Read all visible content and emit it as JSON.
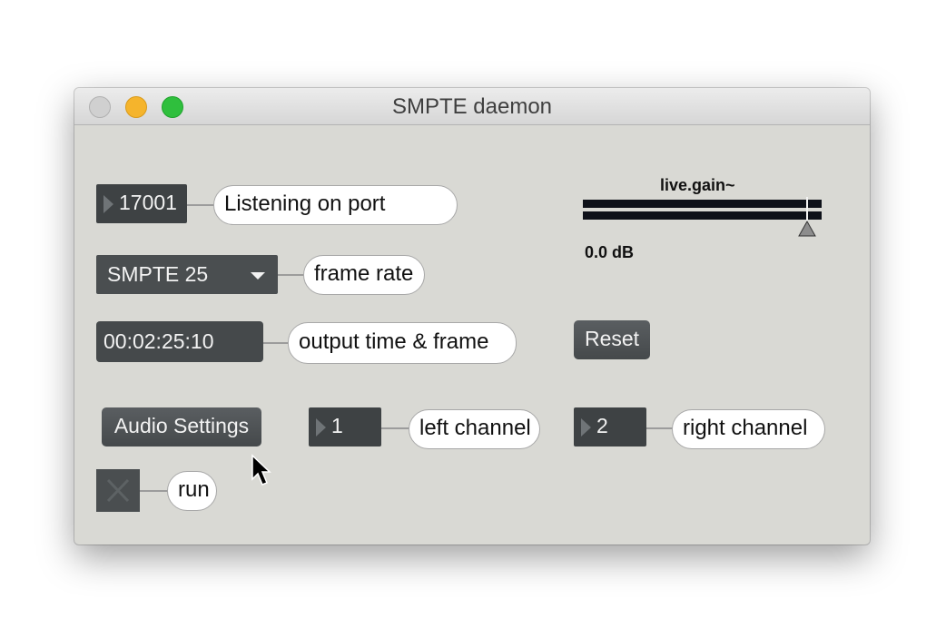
{
  "window": {
    "title": "SMPTE daemon"
  },
  "port": {
    "value": "17001",
    "label": "Listening on port"
  },
  "frame_rate": {
    "selected": "SMPTE 25",
    "label": "frame rate"
  },
  "time": {
    "value": "00:02:25:10",
    "label": "output time & frame"
  },
  "gain": {
    "title": "live.gain~",
    "readout": "0.0 dB",
    "level": 0.94
  },
  "reset_label": "Reset",
  "audio_settings_label": "Audio Settings",
  "left_channel": {
    "value": "1",
    "label": "left channel"
  },
  "right_channel": {
    "value": "2",
    "label": "right channel"
  },
  "run": {
    "label": "run",
    "checked": false
  },
  "colors": {
    "canvas": "#d9d9d4",
    "object": "#3e4244",
    "meter": "#0e1119"
  }
}
